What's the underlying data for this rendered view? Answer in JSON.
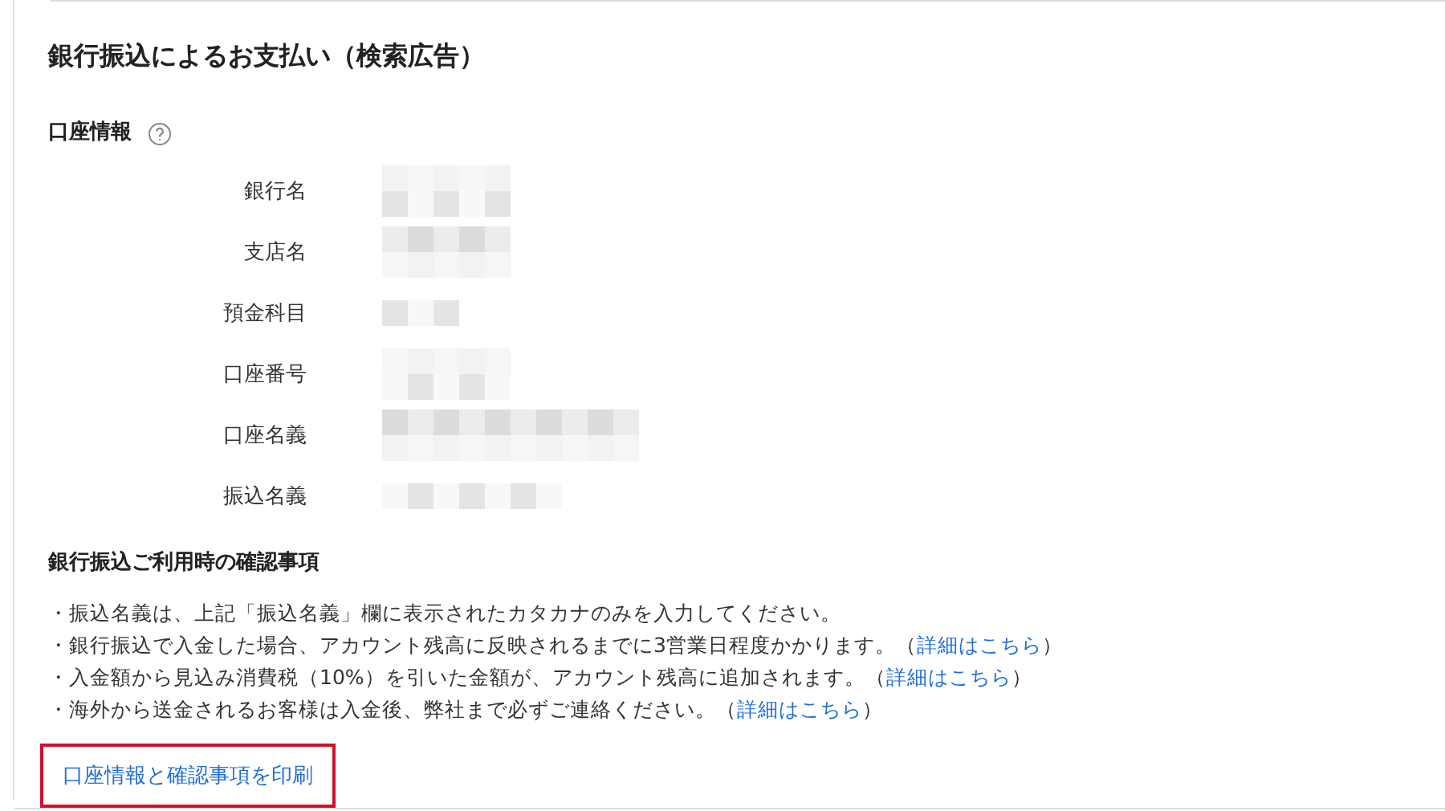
{
  "title": "銀行振込によるお支払い（検索広告）",
  "account_section": {
    "heading": "口座情報",
    "help_icon": true,
    "rows": [
      {
        "label": "銀行名"
      },
      {
        "label": "支店名"
      },
      {
        "label": "預金科目"
      },
      {
        "label": "口座番号"
      },
      {
        "label": "口座名義"
      },
      {
        "label": "振込名義"
      }
    ]
  },
  "notes_section": {
    "heading": "銀行振込ご利用時の確認事項",
    "items": [
      {
        "text": "・振込名義は、上記「振込名義」欄に表示されたカタカナのみを入力してください。"
      },
      {
        "text": "・銀行振込で入金した場合、アカウント残高に反映されるまでに3営業日程度かかります。（",
        "link": "詳細はこちら",
        "after": "）"
      },
      {
        "text": "・入金額から見込み消費税（10%）を引いた金額が、アカウント残高に追加されます。（",
        "link": "詳細はこちら",
        "after": "）"
      },
      {
        "text": "・海外から送金されるお客様は入金後、弊社まで必ずご連絡ください。（",
        "link": "詳細はこちら",
        "after": "）"
      }
    ]
  },
  "print_link": {
    "label": "口座情報と確認事項を印刷",
    "focused": true
  }
}
